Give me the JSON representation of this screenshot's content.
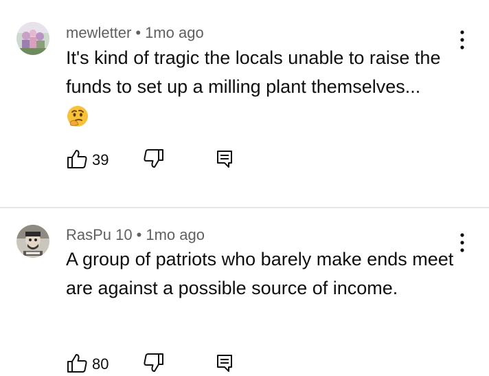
{
  "comments": [
    {
      "author": "mewletter",
      "separator": "•",
      "time": "1mo ago",
      "text": "It's kind of tragic the locals unable to raise the funds to set up a milling plant themselves...",
      "emoji": "thinking-face",
      "likes": "39"
    },
    {
      "author": "RasPu 10",
      "separator": "•",
      "time": "1mo ago",
      "text": "A group of patriots who barely make ends meet are against a possible source of income.",
      "likes": "80"
    }
  ],
  "icons": {
    "like": "thumbs-up-icon",
    "dislike": "thumbs-down-icon",
    "reply": "reply-comment-icon",
    "menu": "more-vertical-icon"
  },
  "colors": {
    "text": "#0f0f0f",
    "meta": "#606060",
    "divider": "#e6e6e6"
  }
}
